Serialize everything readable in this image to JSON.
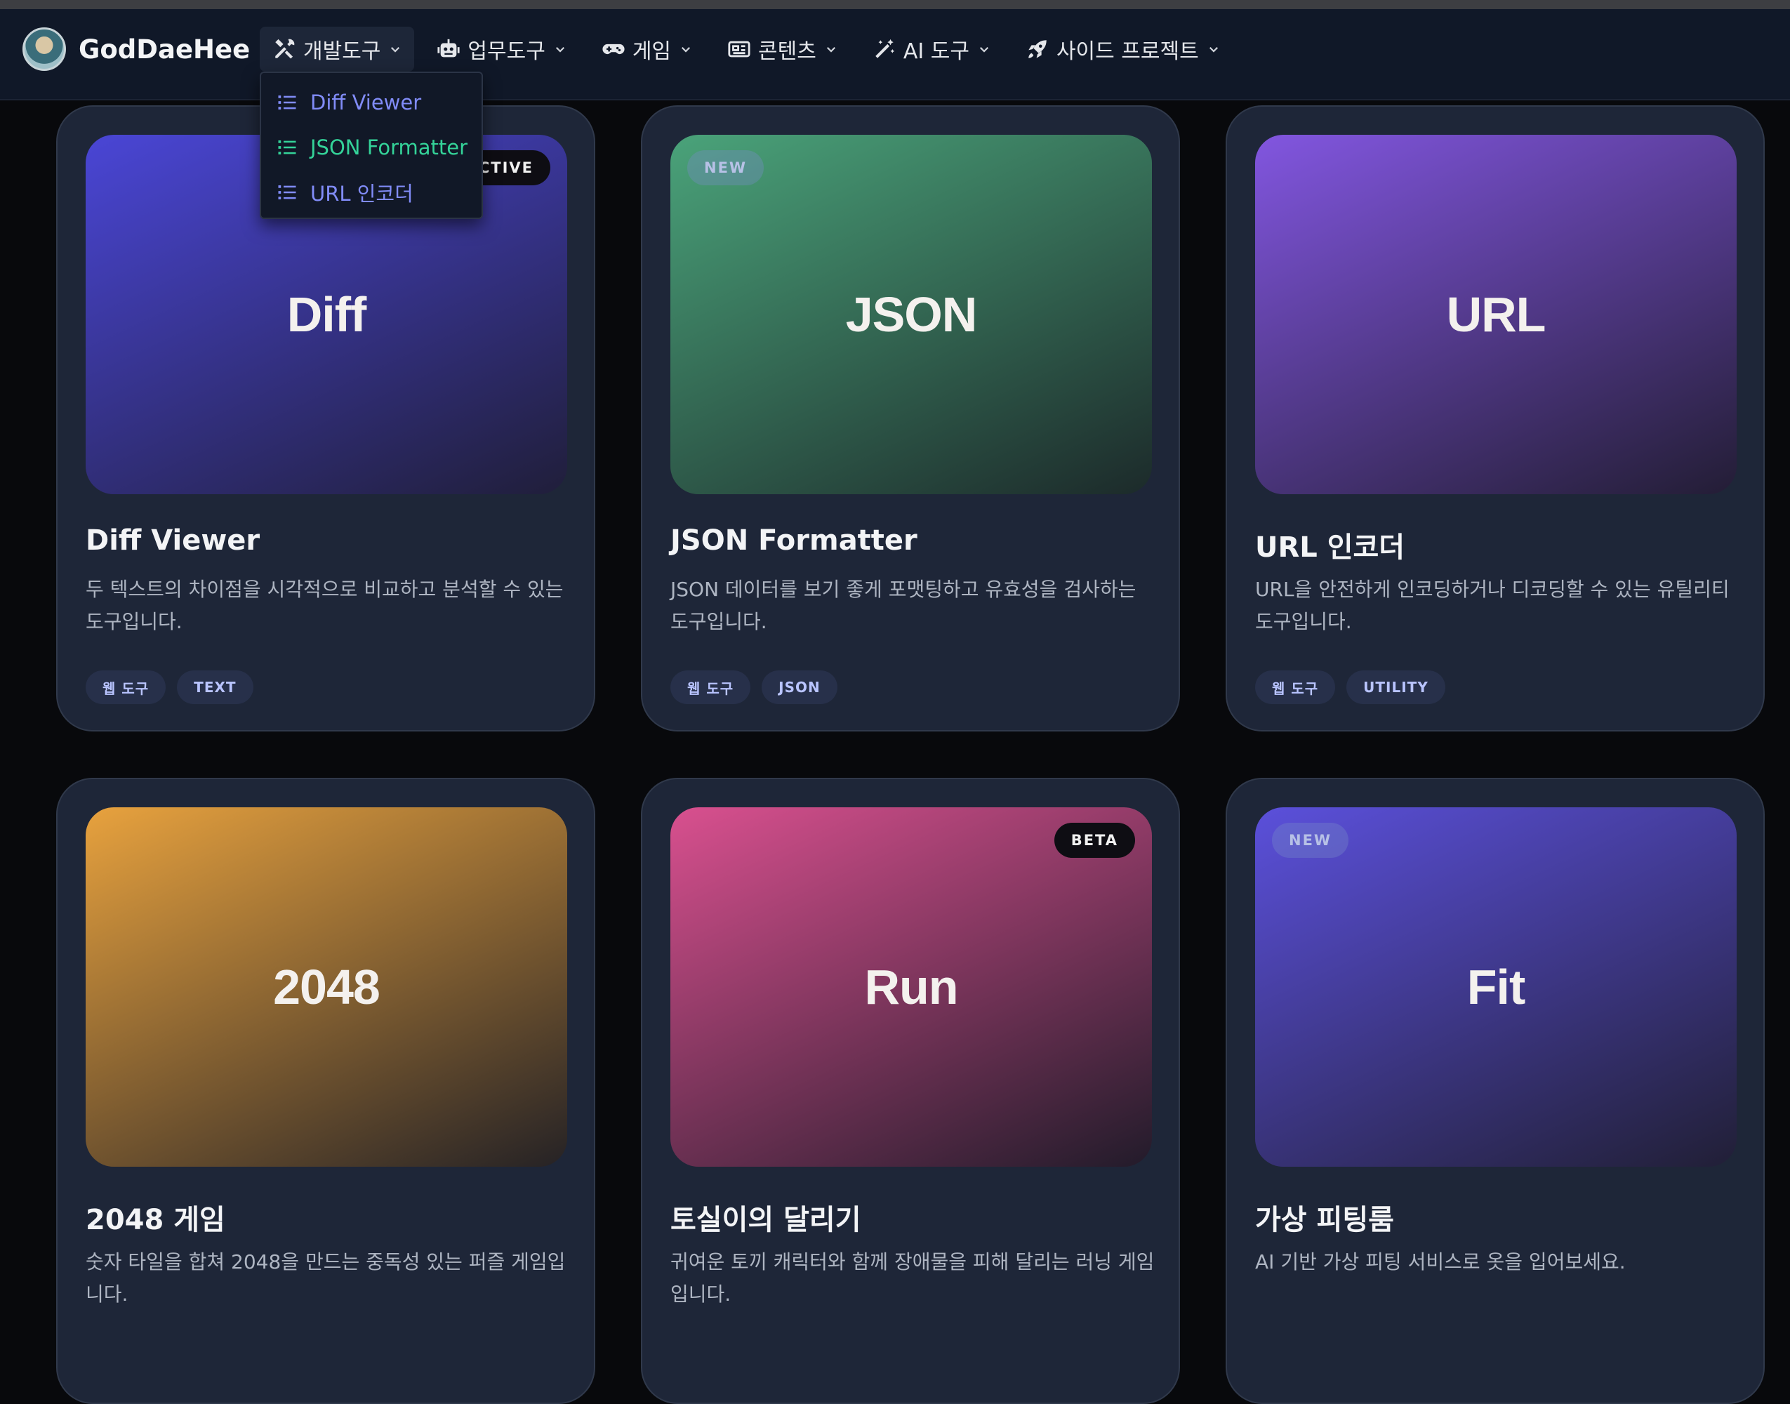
{
  "brand": {
    "name": "GodDaeHee"
  },
  "nav": {
    "items": [
      {
        "label": "개발도구",
        "icon": "tools-icon"
      },
      {
        "label": "업무도구",
        "icon": "robot-icon"
      },
      {
        "label": "게임",
        "icon": "gamepad-icon"
      },
      {
        "label": "콘텐츠",
        "icon": "newspaper-icon"
      },
      {
        "label": "AI 도구",
        "icon": "magic-wand-icon"
      },
      {
        "label": "사이드 프로젝트",
        "icon": "rocket-icon"
      }
    ],
    "dropdown": [
      {
        "label": "Diff Viewer",
        "color": "#818cf8"
      },
      {
        "label": "JSON Formatter",
        "color": "#34d399"
      },
      {
        "label": "URL 인코더",
        "color": "#818cf8"
      }
    ]
  },
  "cards": [
    {
      "thumb": "Diff",
      "badge": "ACTIVE",
      "title": "Diff Viewer",
      "desc": "두 텍스트의 차이점을 시각적으로 비교하고 분석할 수 있는 도구입니다.",
      "tags": [
        "웹 도구",
        "TEXT"
      ],
      "gradient": [
        "#4a46d6",
        "#201e3a"
      ]
    },
    {
      "thumb": "JSON",
      "badge": "NEW",
      "title": "JSON Formatter",
      "desc": "JSON 데이터를 보기 좋게 포맷팅하고 유효성을 검사하는 도구입니다.",
      "tags": [
        "웹 도구",
        "JSON"
      ],
      "gradient": [
        "#4aa37a",
        "#1c2a2a"
      ]
    },
    {
      "thumb": "URL",
      "title": "URL 인코더",
      "desc": "URL을 안전하게 인코딩하거나 디코딩할 수 있는 유틸리티 도구입니다.",
      "tags": [
        "웹 도구",
        "UTILITY"
      ],
      "gradient": [
        "#8256e0",
        "#231d35"
      ]
    },
    {
      "thumb": "2048",
      "title": "2048 게임",
      "desc": "숫자 타일을 합쳐 2048을 만드는 중독성 있는 퍼즐 게임입니다.",
      "gradient": [
        "#e8a23e",
        "#252225"
      ]
    },
    {
      "thumb": "Run",
      "badge": "BETA",
      "title": "토실이의 달리기",
      "desc": "귀여운 토끼 캐릭터와 함께 장애물을 피해 달리는 러닝 게임입니다.",
      "gradient": [
        "#d9508f",
        "#221b2a"
      ]
    },
    {
      "thumb": "Fit",
      "badge": "NEW",
      "title": "가상 피팅룸",
      "desc": "AI 기반 가상 피팅 서비스로 옷을 입어보세요.",
      "gradient": [
        "#5b50db",
        "#211f36"
      ]
    }
  ]
}
